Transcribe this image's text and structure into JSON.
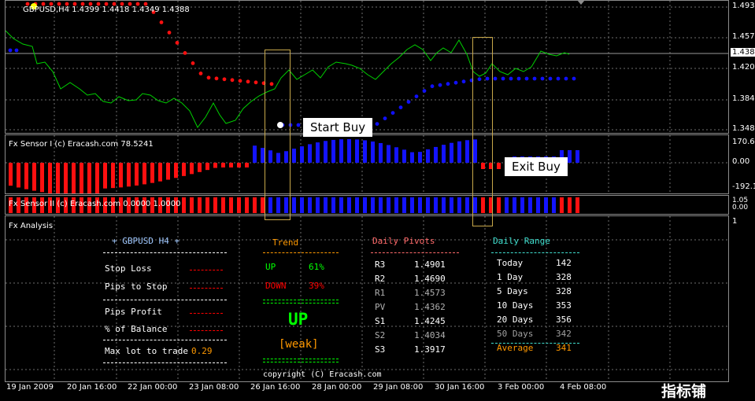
{
  "price": {
    "title": "GBPUSD,H4  1.4399 1.4418 1.4349 1.4388",
    "ylabels": [
      "1.493",
      "1.457",
      "1.420",
      "1.384",
      "1.348"
    ],
    "current": "1.438"
  },
  "sensor1": {
    "title": "Fx Sensor I (c) Eracash.com 78.5241",
    "ylabels": [
      "170.6",
      "0.00",
      "-192.1"
    ]
  },
  "sensor2": {
    "title": "Fx Sensor II (c) Eracash.com 0.0000 1.0000",
    "ylabels": [
      "1.05",
      "0.00"
    ]
  },
  "analysis": {
    "title": "Fx Analysis",
    "ylabel": "1",
    "symbol_header": "+  GBPUSD  H4  +",
    "rows": [
      {
        "label": "Stop Loss",
        "value": ""
      },
      {
        "label": "Pips to Stop",
        "value": ""
      },
      {
        "label": "Pips Profit",
        "value": ""
      },
      {
        "label": "% of Balance",
        "value": ""
      },
      {
        "label": "Max lot to trade",
        "value": "0.29"
      }
    ],
    "trend": {
      "title": "Trend",
      "up_label": "UP",
      "up_pct": "61%",
      "down_label": "DOWN",
      "down_pct": "39%",
      "signal": "UP",
      "strength": "[weak]"
    },
    "pivots": {
      "title": "Daily Pivots",
      "rows": [
        {
          "label": "R3",
          "value": "1.4901"
        },
        {
          "label": "R2",
          "value": "1.4690"
        },
        {
          "label": "R1",
          "value": "1.4573"
        },
        {
          "label": "PV",
          "value": "1.4362"
        },
        {
          "label": "S1",
          "value": "1.4245"
        },
        {
          "label": "S2",
          "value": "1.4034"
        },
        {
          "label": "S3",
          "value": "1.3917"
        }
      ]
    },
    "range": {
      "title": "Daily Range",
      "rows": [
        {
          "label": "Today",
          "value": "142"
        },
        {
          "label": "1 Day",
          "value": "328"
        },
        {
          "label": "5 Days",
          "value": "328"
        },
        {
          "label": "10 Days",
          "value": "353"
        },
        {
          "label": "20 Days",
          "value": "356"
        },
        {
          "label": "50 Days",
          "value": "342"
        },
        {
          "label": "Average",
          "value": "341"
        }
      ]
    },
    "copyright": "copyright (C) Eracash.com"
  },
  "callouts": {
    "start_buy": "Start Buy",
    "exit_buy": "Exit Buy"
  },
  "xaxis": [
    "19 Jan 2009",
    "20 Jan 16:00",
    "22 Jan 00:00",
    "23 Jan 08:00",
    "26 Jan 16:00",
    "28 Jan 00:00",
    "29 Jan 08:00",
    "30 Jan 16:00",
    "3 Feb 00:00",
    "4 Feb 08:00"
  ],
  "watermark": "指标铺",
  "colors": {
    "green": "#00ff00",
    "red": "#ff0000",
    "blue": "#1010ff",
    "orange": "#ff9900",
    "grid": "#8c8c8c"
  }
}
